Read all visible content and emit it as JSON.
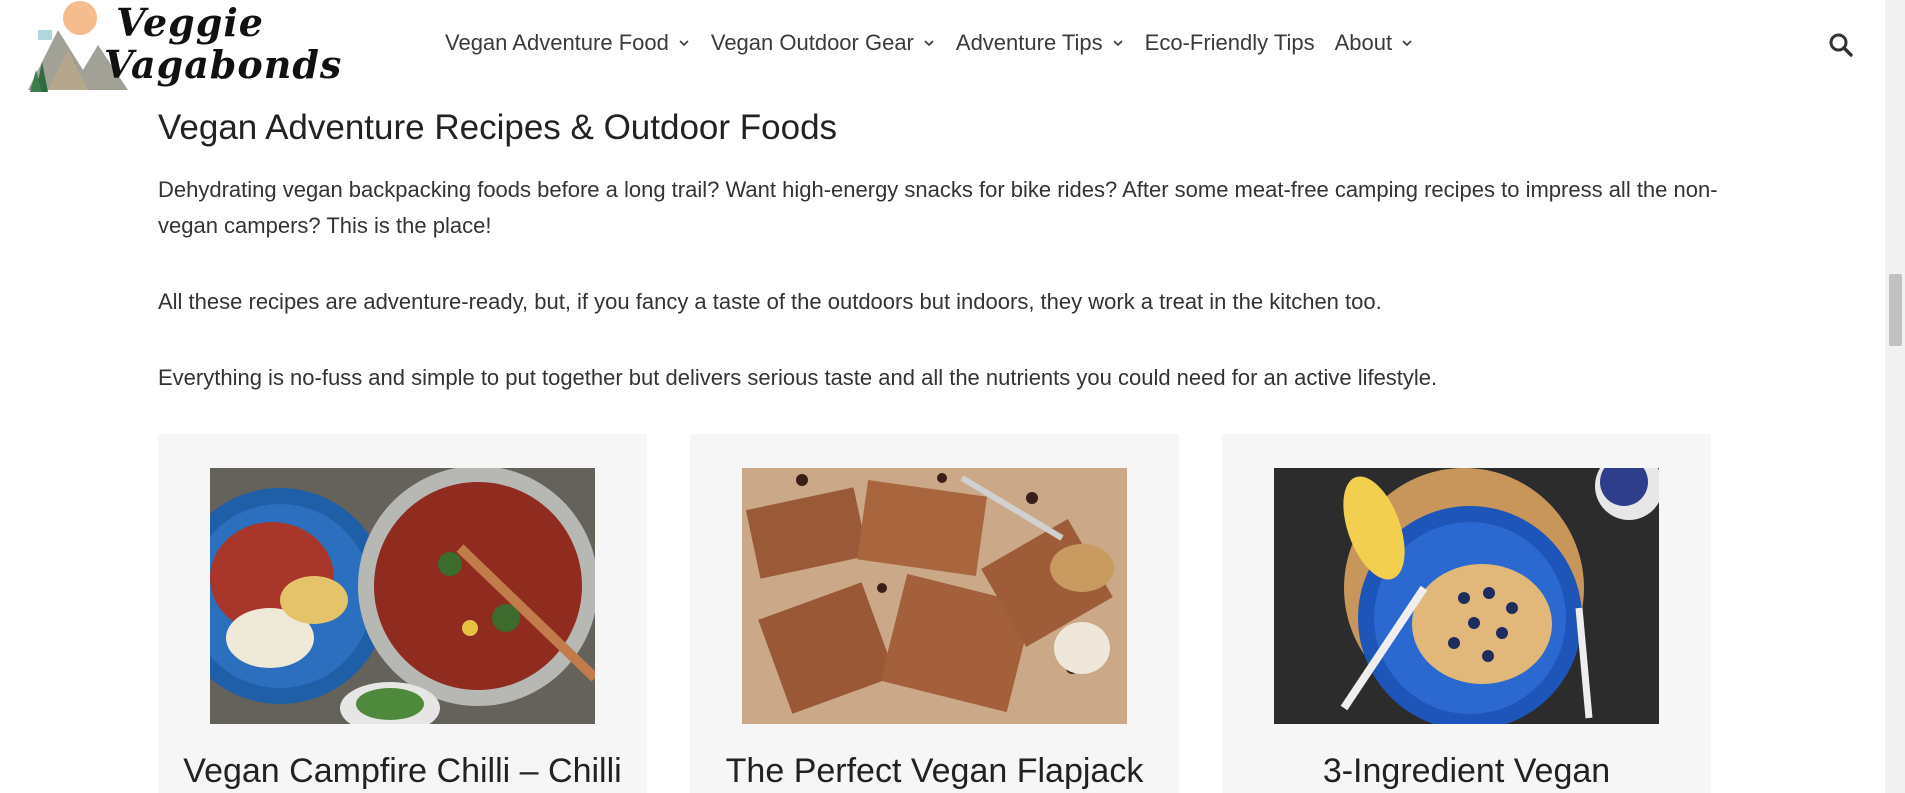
{
  "logo": {
    "line1": "Veggie",
    "line2": "Vagabonds"
  },
  "nav": {
    "items": [
      {
        "label": "Vegan Adventure Food",
        "dropdown": true
      },
      {
        "label": "Vegan Outdoor Gear",
        "dropdown": true
      },
      {
        "label": "Adventure Tips",
        "dropdown": true
      },
      {
        "label": "Eco-Friendly Tips",
        "dropdown": false
      },
      {
        "label": "About",
        "dropdown": true
      }
    ],
    "search_icon": "search-icon"
  },
  "main": {
    "title": "Vegan Adventure Recipes & Outdoor Foods",
    "paragraphs": [
      "Dehydrating vegan backpacking foods before a long trail? Want high-energy snacks for bike rides? After some meat-free camping recipes to impress all the non-vegan campers? This is the place!",
      "All these recipes are adventure-ready, but, if you fancy a taste of the outdoors but indoors, they work a treat in the kitchen too.",
      "Everything is no-fuss and simple to put together but delivers serious taste and all the nutrients you could need for an active lifestyle."
    ],
    "cards": [
      {
        "title": "Vegan Campfire Chilli – Chilli",
        "image": "chilli-pot-photo"
      },
      {
        "title": "The Perfect Vegan Flapjack",
        "image": "flapjack-bars-photo"
      },
      {
        "title": "3-Ingredient Vegan",
        "image": "blueberry-pancake-photo"
      }
    ]
  },
  "colors": {
    "text": "#333333",
    "card_bg": "#f6f6f6",
    "accent_blue": "#2a5fc4"
  }
}
